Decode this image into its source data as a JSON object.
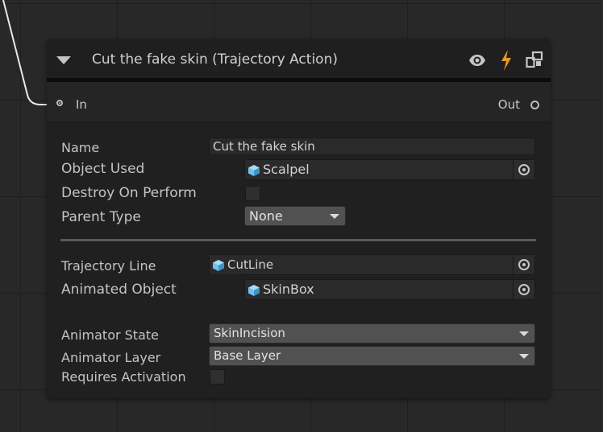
{
  "node": {
    "title": "Cut the fake skin (Trajectory Action)",
    "icons": [
      "collapse-triangle-icon",
      "eye-icon",
      "lightning-icon",
      "node-settings-icon"
    ],
    "ports": {
      "in_label": "In",
      "out_label": "Out"
    }
  },
  "fields": {
    "name": {
      "label": "Name",
      "value": "Cut the fake skin"
    },
    "object_used": {
      "label": "Object Used",
      "value": "Scalpel"
    },
    "destroy_on_perform": {
      "label": "Destroy On Perform",
      "checked": false
    },
    "parent_type": {
      "label": "Parent Type",
      "value": "None"
    },
    "trajectory_line": {
      "label": "Trajectory Line",
      "value": "CutLine"
    },
    "animated_object": {
      "label": "Animated Object",
      "value": "SkinBox"
    },
    "animator_state": {
      "label": "Animator State",
      "value": "SkinIncision"
    },
    "animator_layer": {
      "label": "Animator Layer",
      "value": "Base Layer"
    },
    "requires_activation": {
      "label": "Requires Activation",
      "checked": false
    }
  },
  "colors": {
    "lightning": "#e59a2a",
    "object_icon": "#6fc1f2",
    "panel": "#202020",
    "dropdown": "#515151"
  }
}
